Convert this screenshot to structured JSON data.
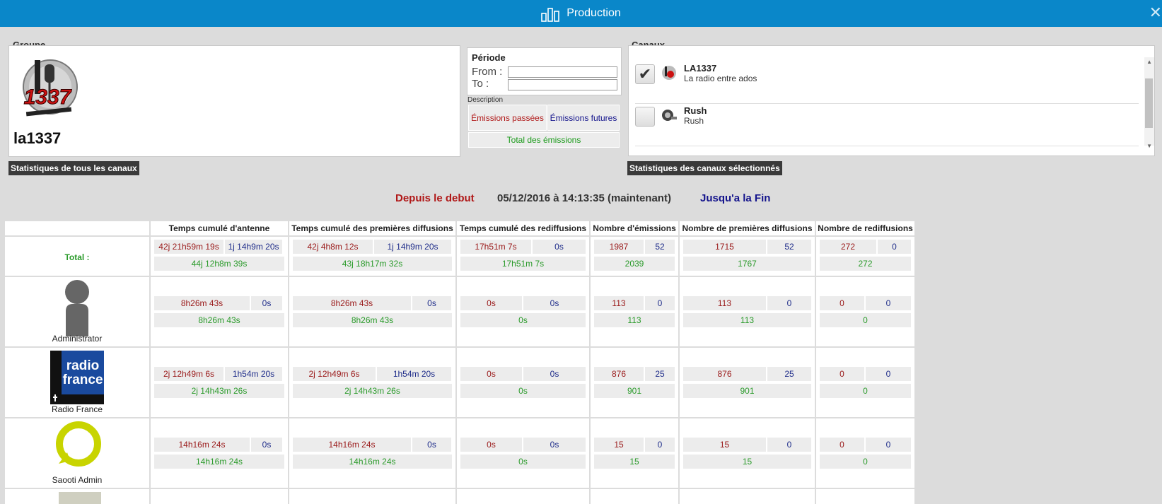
{
  "window": {
    "title": "Production",
    "title_icon": "bar-chart-icon",
    "close_icon": "close-icon"
  },
  "groupe": {
    "label": "Groupe",
    "name": "la1337",
    "logo_text": "1337",
    "stats_button": "Statistiques de tous les canaux"
  },
  "periode": {
    "title": "Période",
    "from_label": "From :",
    "to_label": "To :",
    "from_value": "",
    "to_value": ""
  },
  "description": {
    "label": "Description",
    "past": "Émissions passées",
    "future": "Émissions futures",
    "total": "Total des émissions"
  },
  "canaux": {
    "label": "Canaux",
    "stats_button": "Statistiques des canaux sélectionnés",
    "items": [
      {
        "name": "LA1337",
        "desc": "La radio entre ados",
        "checked": true
      },
      {
        "name": "Rush",
        "desc": "Rush",
        "checked": false
      }
    ]
  },
  "nav": {
    "since_start": "Depuis le debut",
    "now": "05/12/2016 à 14:13:35 (maintenant)",
    "until_end": "Jusqu'a la Fin"
  },
  "colors": {
    "past": "#9a1a1a",
    "future": "#1f2d8a",
    "total": "#2a9a2a",
    "titlebar": "#0a87c9"
  },
  "table": {
    "headers": [
      "Temps cumulé d'antenne",
      "Temps cumulé des premières diffusions",
      "Temps cumulé des rediffusions",
      "Nombre d'émissions",
      "Nombre de premières diffusions",
      "Nombre de rediffusions"
    ],
    "rows": [
      {
        "label": "Total :",
        "cells": [
          {
            "p": "42j 21h59m 19s",
            "f": "1j 14h9m 20s",
            "t": "44j 12h8m 39s"
          },
          {
            "p": "42j 4h8m 12s",
            "f": "1j 14h9m 20s",
            "t": "43j 18h17m 32s"
          },
          {
            "p": "17h51m 7s",
            "f": "0s",
            "t": "17h51m 7s"
          },
          {
            "p": "1987",
            "f": "52",
            "t": "2039"
          },
          {
            "p": "1715",
            "f": "52",
            "t": "1767"
          },
          {
            "p": "272",
            "f": "0",
            "t": "272"
          }
        ]
      },
      {
        "label": "Administrator",
        "icon": "person-icon",
        "cells": [
          {
            "p": "8h26m 43s",
            "f": "0s",
            "t": "8h26m 43s"
          },
          {
            "p": "8h26m 43s",
            "f": "0s",
            "t": "8h26m 43s"
          },
          {
            "p": "0s",
            "f": "0s",
            "t": "0s"
          },
          {
            "p": "113",
            "f": "0",
            "t": "113"
          },
          {
            "p": "113",
            "f": "0",
            "t": "113"
          },
          {
            "p": "0",
            "f": "0",
            "t": "0"
          }
        ]
      },
      {
        "label": "Radio France",
        "icon": "radio-france-logo",
        "logo_line1": "radio",
        "logo_line2": "france",
        "cells": [
          {
            "p": "2j 12h49m 6s",
            "f": "1h54m 20s",
            "t": "2j 14h43m 26s"
          },
          {
            "p": "2j 12h49m 6s",
            "f": "1h54m 20s",
            "t": "2j 14h43m 26s"
          },
          {
            "p": "0s",
            "f": "0s",
            "t": "0s"
          },
          {
            "p": "876",
            "f": "25",
            "t": "901"
          },
          {
            "p": "876",
            "f": "25",
            "t": "901"
          },
          {
            "p": "0",
            "f": "0",
            "t": "0"
          }
        ]
      },
      {
        "label": "Saooti Admin",
        "icon": "saooti-logo",
        "cells": [
          {
            "p": "14h16m 24s",
            "f": "0s",
            "t": "14h16m 24s"
          },
          {
            "p": "14h16m 24s",
            "f": "0s",
            "t": "14h16m 24s"
          },
          {
            "p": "0s",
            "f": "0s",
            "t": "0s"
          },
          {
            "p": "15",
            "f": "0",
            "t": "15"
          },
          {
            "p": "15",
            "f": "0",
            "t": "15"
          },
          {
            "p": "0",
            "f": "0",
            "t": "0"
          }
        ]
      }
    ]
  }
}
